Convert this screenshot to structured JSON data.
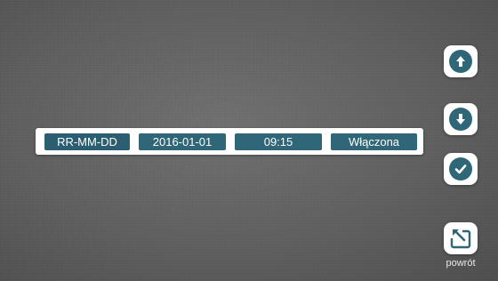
{
  "settings_row": {
    "format": "RR-MM-DD",
    "date": "2016-01-01",
    "time": "09:15",
    "state": "Włączona"
  },
  "buttons": {
    "up_icon": "arrow-up-icon",
    "down_icon": "arrow-down-icon",
    "confirm_icon": "checkmark-icon",
    "back_icon": "return-icon",
    "back_label": "powrót"
  },
  "colors": {
    "accent": "#2f6678",
    "panel": "#ffffff",
    "background": "#5f5f5f"
  }
}
